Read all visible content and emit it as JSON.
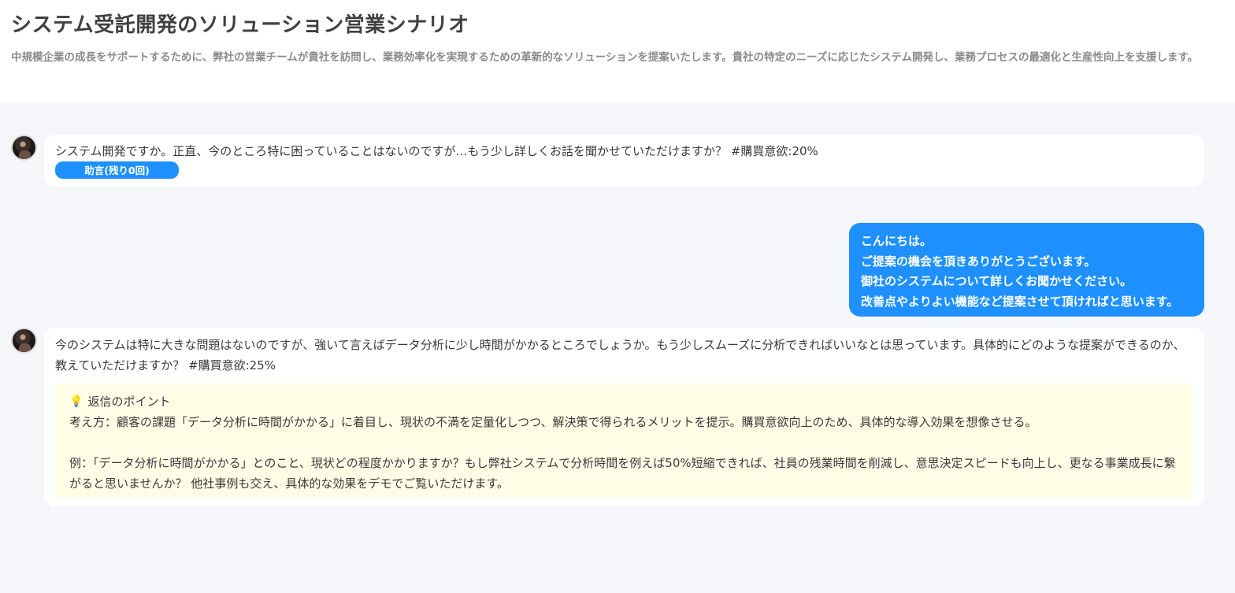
{
  "header": {
    "title": "システム受託開発のソリューション営業シナリオ",
    "description": "中規模企業の成長をサポートするために、弊社の営業チームが貴社を訪問し、業務効率化を実現するための革新的なソリューションを提案いたします。貴社の特定のニーズに応じたシステム開発し、業務プロセスの最適化と生産性向上を支援します。"
  },
  "messages": [
    {
      "role": "customer",
      "text": "システム開発ですか。正直、今のところ特に困っていることはないのですが…もう少し詳しくお話を聞かせていただけますか？ #購買意欲:20%",
      "advice_button": "助言(残り0回)"
    },
    {
      "role": "user",
      "lines": [
        "こんにちは。",
        "ご提案の機会を頂きありがとうございます。",
        "御社のシステムについて詳しくお聞かせください。",
        "改善点やよりよい機能など提案させて頂ければと思います。"
      ]
    },
    {
      "role": "customer",
      "text": "今のシステムは特に大きな問題はないのですが、強いて言えばデータ分析に少し時間がかかるところでしょうか。もう少しスムーズに分析できればいいなとは思っています。具体的にどのような提案ができるのか、教えていただけますか？ #購買意欲:25%",
      "hint": {
        "icon": "lightbulb-icon",
        "title": "返信のポイント",
        "approach": "考え方：顧客の課題「データ分析に時間がかかる」に着目し、現状の不満を定量化しつつ、解決策で得られるメリットを提示。購買意欲向上のため、具体的な導入効果を想像させる。",
        "example": "例：「データ分析に時間がかかる」とのこと、現状どの程度かかりますか？もし弊社システムで分析時間を例えば50%短縮できれば、社員の残業時間を削減し、意思決定スピードも向上し、更なる事業成長に繋がると思いませんか？ 他社事例も交え、具体的な効果をデモでご覧いただけます。"
      }
    }
  ],
  "colors": {
    "accent": "#1e90ff",
    "background": "#f5f6f9",
    "hint_background": "#fffde6"
  }
}
